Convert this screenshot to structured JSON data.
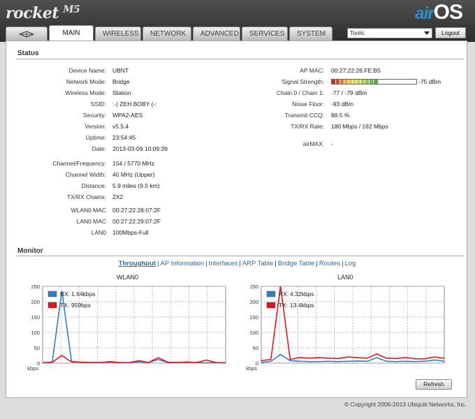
{
  "header": {
    "brand": "rocket",
    "model": "M5",
    "os_air": "air",
    "os_name": "OS"
  },
  "tabs": [
    "MAIN",
    "WIRELESS",
    "NETWORK",
    "ADVANCED",
    "SERVICES",
    "SYSTEM"
  ],
  "active_tab": "MAIN",
  "tools": {
    "label": "Tools:"
  },
  "logout": "Logout",
  "status": {
    "title": "Status",
    "left": [
      {
        "label": "Device Name:",
        "value": "UBNT"
      },
      {
        "label": "Network Mode:",
        "value": "Bridge"
      },
      {
        "label": "Wireless Mode:",
        "value": "Station"
      },
      {
        "label": "SSID:",
        "value": ":-) ZEH BOBY (-:"
      },
      {
        "label": "Security:",
        "value": "WPA2-AES"
      },
      {
        "label": "Version:",
        "value": "v5.5.4"
      },
      {
        "label": "Uptime:",
        "value": "23:54:45"
      },
      {
        "label": "Date:",
        "value": "2013-03-09 10:09:39"
      },
      {
        "label": "Channel/Frequency:",
        "value": "154 / 5770 MHz"
      },
      {
        "label": "Channel Width:",
        "value": "40 MHz (Upper)"
      },
      {
        "label": "Distance:",
        "value": "5.9 miles (9.5 km)"
      },
      {
        "label": "TX/RX Chains:",
        "value": "2X2"
      },
      {
        "label": "WLAN0 MAC",
        "value": "00:27:22:28:07:2F"
      },
      {
        "label": "LAN0 MAC",
        "value": "00:27:22:29:07:2F"
      },
      {
        "label": "LAN0",
        "value": "100Mbps-Full"
      }
    ],
    "right": [
      {
        "label": "AP MAC:",
        "value": "00:27:22:26:FE:B5"
      },
      {
        "label": "Signal Strength:",
        "value": "-75 dBm"
      },
      {
        "label": "Chain 0 / Chain 1:",
        "value": "-77 / -79 dBm"
      },
      {
        "label": "Noise Floor:",
        "value": "-93 dBm"
      },
      {
        "label": "Transmit CCQ:",
        "value": "88.5 %"
      },
      {
        "label": "TX/RX Rate:",
        "value": "180 Mbps / 162 Mbps"
      },
      {
        "label": "airMAX:",
        "value": "-"
      }
    ],
    "signal_fill_fraction": 0.53,
    "signal_colors": [
      "#d8261c",
      "#e8491d",
      "#f07a1f",
      "#f5a623",
      "#f6c623",
      "#e6d92a",
      "#c9dc30",
      "#a8d434",
      "#86c93a",
      "#64bd3f",
      "#4cb244"
    ]
  },
  "monitor": {
    "title": "Monitor",
    "links": [
      "Throughput",
      "AP Information",
      "Interfaces",
      "ARP Table",
      "Bridge Table",
      "Routes",
      "Log"
    ],
    "active_link": "Throughput",
    "refresh": "Refresh"
  },
  "chart_data": [
    {
      "type": "line",
      "title": "WLAN0",
      "ylabel": "kbps",
      "ylim": [
        0,
        250
      ],
      "yticks": [
        0,
        50,
        100,
        150,
        200,
        250
      ],
      "legend": [
        {
          "name": "RX:",
          "value": "1.64kbps",
          "color": "#2f80c4"
        },
        {
          "name": "TX:",
          "value": "959bps",
          "color": "#e0161f"
        }
      ],
      "series": [
        {
          "name": "RX",
          "color": "#2f80c4",
          "values": [
            1,
            4,
            235,
            6,
            3,
            2,
            2,
            3,
            1,
            2,
            4,
            2,
            12,
            2,
            2,
            3,
            2,
            1,
            2,
            1
          ]
        },
        {
          "name": "TX",
          "color": "#e0161f",
          "values": [
            1,
            3,
            25,
            4,
            3,
            2,
            2,
            5,
            2,
            2,
            8,
            2,
            18,
            3,
            2,
            4,
            2,
            10,
            2,
            1
          ]
        }
      ]
    },
    {
      "type": "line",
      "title": "LAN0",
      "ylabel": "kbps",
      "ylim": [
        0,
        250
      ],
      "yticks": [
        0,
        50,
        100,
        150,
        200,
        250
      ],
      "legend": [
        {
          "name": "RX:",
          "value": "4.32kbps",
          "color": "#2f80c4"
        },
        {
          "name": "TX:",
          "value": "13.4kbps",
          "color": "#e0161f"
        }
      ],
      "series": [
        {
          "name": "RX",
          "color": "#2f80c4",
          "values": [
            2,
            6,
            28,
            8,
            6,
            5,
            5,
            6,
            5,
            6,
            7,
            6,
            18,
            6,
            5,
            6,
            5,
            6,
            10,
            6
          ]
        },
        {
          "name": "TX",
          "color": "#e0161f",
          "values": [
            8,
            12,
            250,
            12,
            18,
            16,
            18,
            16,
            15,
            20,
            18,
            16,
            30,
            16,
            15,
            18,
            14,
            14,
            20,
            16
          ]
        }
      ]
    }
  ],
  "copyright": "© Copyright 2006-2013 Ubiquiti Networks, Inc."
}
